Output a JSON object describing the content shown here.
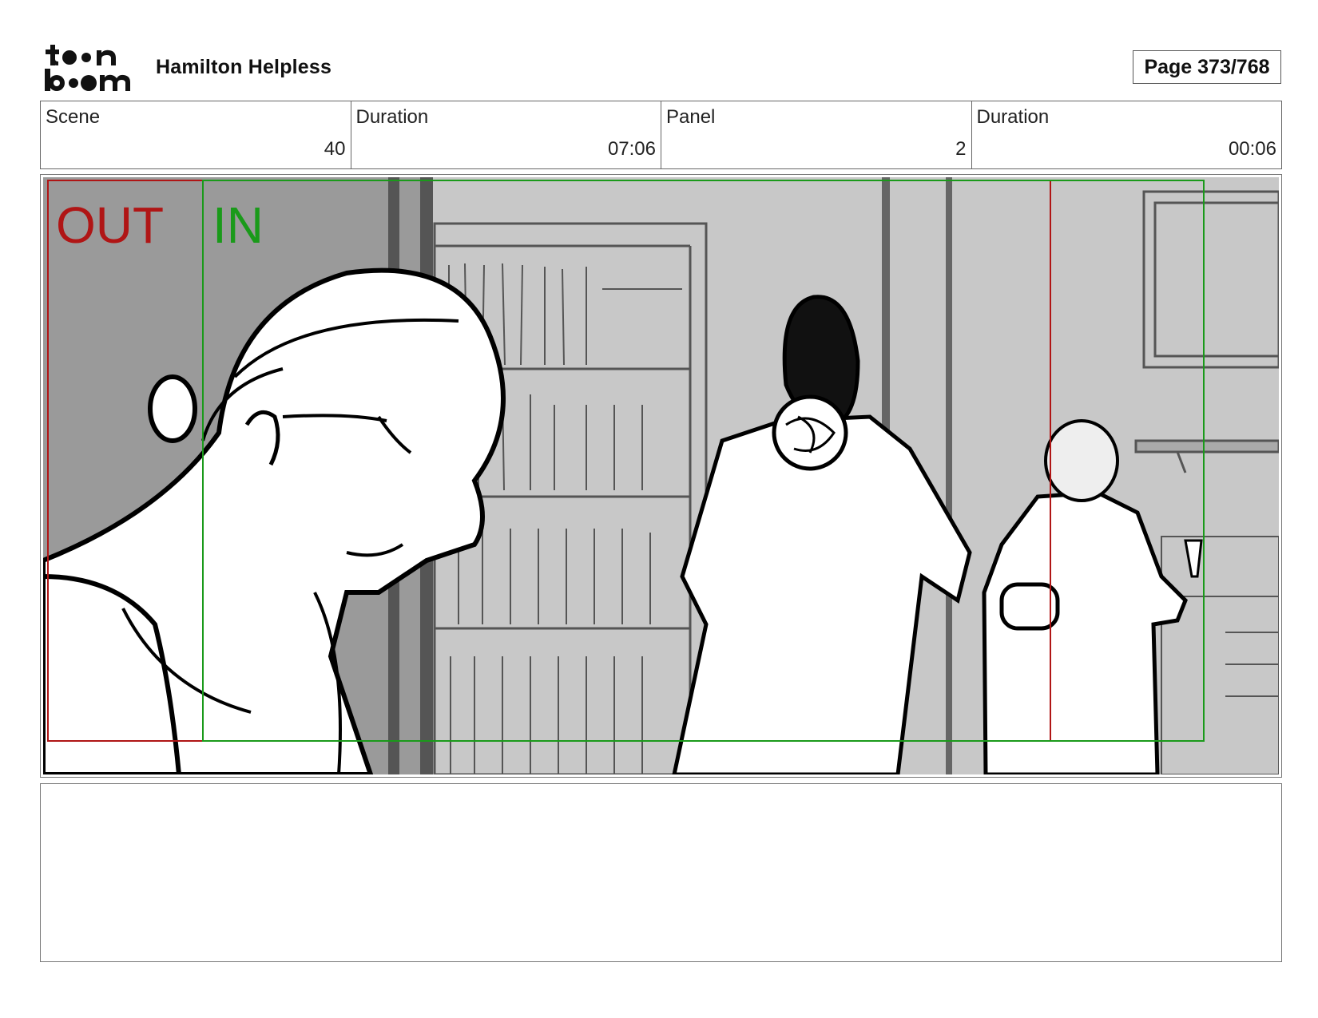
{
  "header": {
    "logo_text": "toon boom",
    "project_title": "Hamilton Helpless",
    "page_label": "Page 373/768"
  },
  "info": [
    {
      "label": "Scene",
      "value": "40"
    },
    {
      "label": "Duration",
      "value": "07:06"
    },
    {
      "label": "Panel",
      "value": "2"
    },
    {
      "label": "Duration",
      "value": "00:06"
    }
  ],
  "panel": {
    "out_label": "OUT",
    "in_label": "IN",
    "colors": {
      "out": "#b01515",
      "in": "#1a9a1a",
      "background_dark": "#9a9a9a",
      "background_light": "#c8c8c8"
    }
  },
  "notes": {
    "text": ""
  }
}
